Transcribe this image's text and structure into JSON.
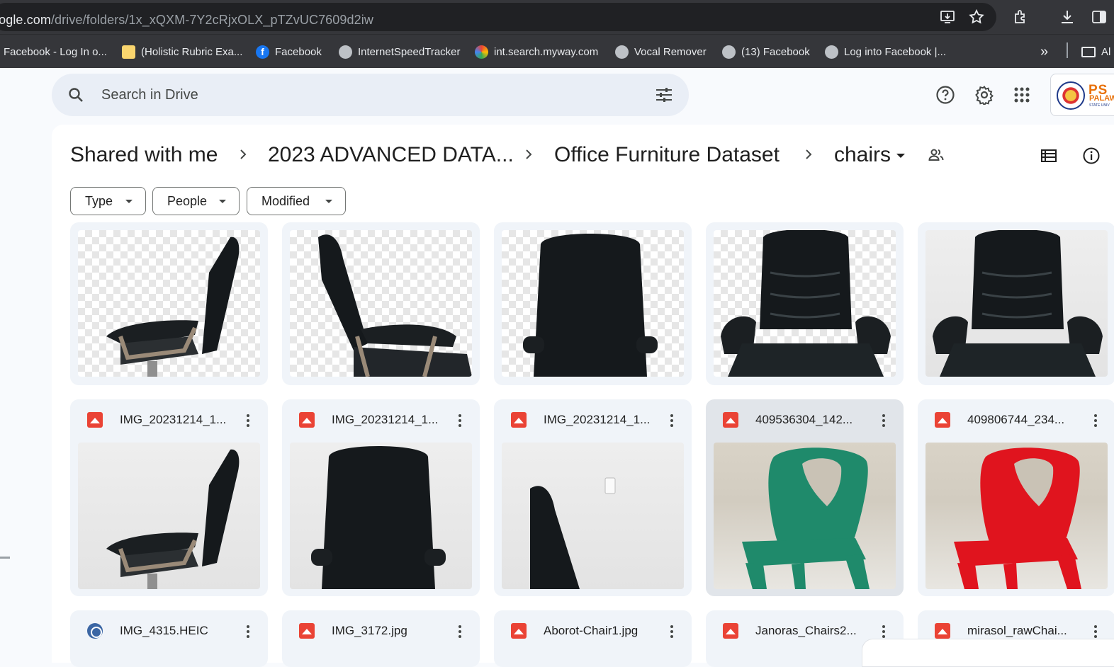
{
  "browser": {
    "url_host": "oogle.com",
    "url_path": "/drive/folders/1x_xQXM-7Y2cRjxOLX_pTZvUC7609d2iw",
    "bookmarks": [
      {
        "label": "Facebook - Log In o...",
        "icon": "none"
      },
      {
        "label": "(Holistic Rubric Exa...",
        "icon": "grid-icon"
      },
      {
        "label": "Facebook",
        "icon": "facebook-icon"
      },
      {
        "label": "InternetSpeedTracker",
        "icon": "globe-icon"
      },
      {
        "label": "int.search.myway.com",
        "icon": "ring-icon"
      },
      {
        "label": "Vocal Remover",
        "icon": "globe-icon"
      },
      {
        "label": "(13) Facebook",
        "icon": "globe-icon"
      },
      {
        "label": "Log into Facebook |...",
        "icon": "globe-icon"
      }
    ],
    "more_bookmarks": "»",
    "all_bookmarks_label": "Al"
  },
  "drive": {
    "search_placeholder": "Search in Drive",
    "org_logo": {
      "line1": "PS",
      "line2": "PALAW",
      "line3": "STATE UNIV"
    },
    "breadcrumb": [
      "Shared with me",
      "2023 ADVANCED DATA...",
      "Office Furniture Dataset",
      "chairs"
    ],
    "filters": [
      "Type",
      "People",
      "Modified"
    ],
    "rows": [
      {
        "files": [
          {
            "name": "",
            "thumb": "checker",
            "kind": "chair-side-left"
          },
          {
            "name": "",
            "thumb": "checker",
            "kind": "chair-side-right"
          },
          {
            "name": "",
            "thumb": "checker",
            "kind": "chair-back"
          },
          {
            "name": "",
            "thumb": "checker",
            "kind": "chair-front"
          },
          {
            "name": "",
            "thumb": "wall",
            "kind": "chair-front"
          }
        ]
      },
      {
        "files": [
          {
            "name": "IMG_20231214_1...",
            "icon": "image-icon",
            "thumb": "wall",
            "kind": "chair-side-left"
          },
          {
            "name": "IMG_20231214_1...",
            "icon": "image-icon",
            "thumb": "wall",
            "kind": "chair-back"
          },
          {
            "name": "IMG_20231214_1...",
            "icon": "image-icon",
            "thumb": "wall",
            "kind": "chair-side-right-partial"
          },
          {
            "name": "409536304_142...",
            "icon": "image-icon",
            "thumb": "tile",
            "kind": "plastic-chair-green",
            "color": "#1f8a6b",
            "selected": true
          },
          {
            "name": "409806744_234...",
            "icon": "image-icon",
            "thumb": "tile",
            "kind": "plastic-chair-red",
            "color": "#e0141e"
          }
        ]
      },
      {
        "files": [
          {
            "name": "IMG_4315.HEIC",
            "icon": "heic-icon"
          },
          {
            "name": "IMG_3172.jpg",
            "icon": "image-icon"
          },
          {
            "name": "Aborot-Chair1.jpg",
            "icon": "image-icon"
          },
          {
            "name": "Janoras_Chairs2...",
            "icon": "image-icon"
          },
          {
            "name": "mirasol_rawChai...",
            "icon": "image-icon"
          }
        ]
      }
    ]
  }
}
